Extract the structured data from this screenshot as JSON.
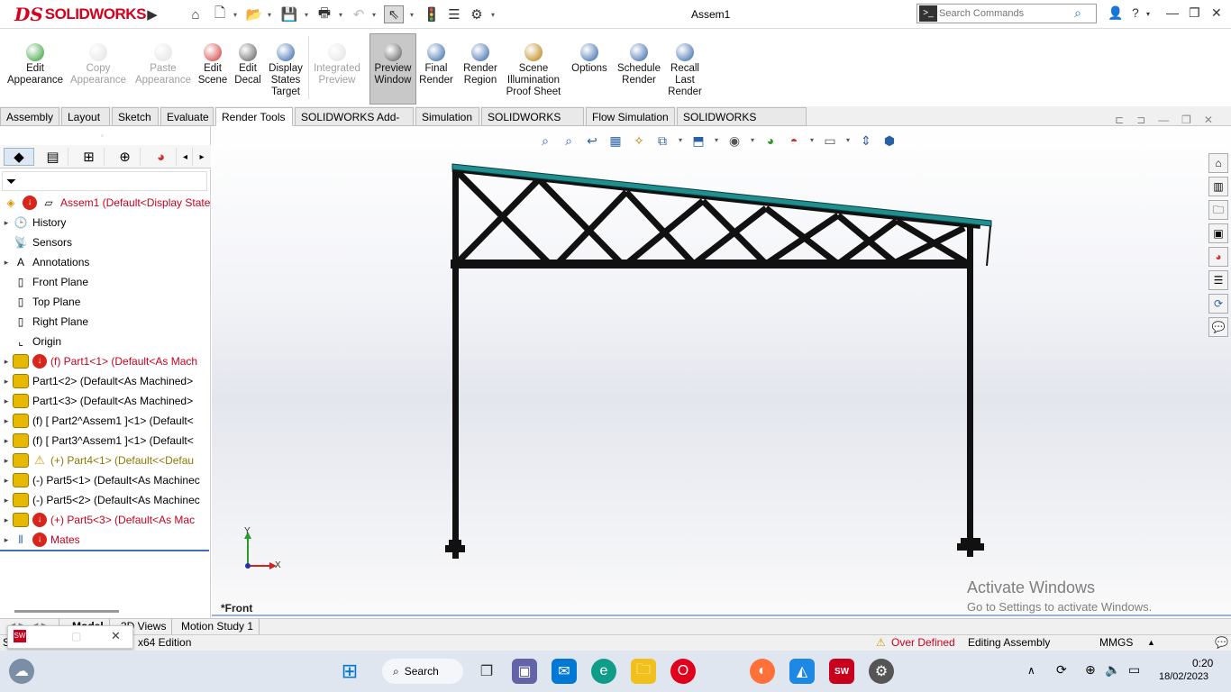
{
  "app": {
    "brand_ds": "DS",
    "brand_name": "SOLIDWORKS",
    "doc_title": "Assem1"
  },
  "search": {
    "placeholder": "Search Commands"
  },
  "ribbon": [
    {
      "label": "Edit\nAppearance",
      "icon": "appearance-icon",
      "enabled": true
    },
    {
      "label": "Copy\nAppearance",
      "icon": "copy-appearance-icon",
      "enabled": false
    },
    {
      "label": "Paste\nAppearance",
      "icon": "paste-appearance-icon",
      "enabled": false
    },
    {
      "label": "Edit\nScene",
      "icon": "scene-icon",
      "enabled": true
    },
    {
      "label": "Edit\nDecal",
      "icon": "decal-icon",
      "enabled": true
    },
    {
      "label": "Display\nStates\nTarget",
      "icon": "target-icon",
      "enabled": true
    },
    {
      "label": "Integrated\nPreview",
      "icon": "integrated-preview-icon",
      "enabled": false
    },
    {
      "label": "Preview\nWindow",
      "icon": "preview-window-icon",
      "enabled": true,
      "active": true
    },
    {
      "label": "Final\nRender",
      "icon": "final-render-icon",
      "enabled": true
    },
    {
      "label": "Render\nRegion",
      "icon": "render-region-icon",
      "enabled": true
    },
    {
      "label": "Scene\nIllumination\nProof Sheet",
      "icon": "proof-sheet-icon",
      "enabled": true
    },
    {
      "label": "Options",
      "icon": "options-icon",
      "enabled": true
    },
    {
      "label": "Schedule\nRender",
      "icon": "schedule-render-icon",
      "enabled": true
    },
    {
      "label": "Recall\nLast\nRender",
      "icon": "recall-render-icon",
      "enabled": true
    }
  ],
  "tabs": [
    "Assembly",
    "Layout",
    "Sketch",
    "Evaluate",
    "Render Tools",
    "SOLIDWORKS Add-Ins",
    "Simulation",
    "SOLIDWORKS MBD",
    "Flow Simulation",
    "SOLIDWORKS Inspection"
  ],
  "selected_tab": "Render Tools",
  "tree": {
    "root": "Assem1  (Default<Display State",
    "items": [
      {
        "label": "History",
        "kind": "history",
        "expand": true
      },
      {
        "label": "Sensors",
        "kind": "sensors",
        "expand": false
      },
      {
        "label": "Annotations",
        "kind": "annotations",
        "expand": true
      },
      {
        "label": "Front Plane",
        "kind": "plane",
        "expand": false
      },
      {
        "label": "Top Plane",
        "kind": "plane",
        "expand": false
      },
      {
        "label": "Right Plane",
        "kind": "plane",
        "expand": false
      },
      {
        "label": "Origin",
        "kind": "origin",
        "expand": false
      },
      {
        "label": "(f) Part1<1> (Default<As Mach",
        "kind": "part",
        "status": "error",
        "expand": true
      },
      {
        "label": "Part1<2> (Default<As Machined>",
        "kind": "part",
        "expand": true
      },
      {
        "label": "Part1<3> (Default<As Machined>",
        "kind": "part",
        "expand": true
      },
      {
        "label": "(f) [ Part2^Assem1 ]<1> (Default<",
        "kind": "part",
        "expand": true
      },
      {
        "label": "(f) [ Part3^Assem1 ]<1> (Default<",
        "kind": "part",
        "expand": true
      },
      {
        "label": "(+) Part4<1> (Default<<Defau",
        "kind": "part",
        "status": "warning",
        "expand": true
      },
      {
        "label": "(-) Part5<1> (Default<As Machinec",
        "kind": "part",
        "expand": true
      },
      {
        "label": "(-) Part5<2> (Default<As Machinec",
        "kind": "part",
        "expand": true
      },
      {
        "label": "(+) Part5<3> (Default<As Mac",
        "kind": "part",
        "status": "error",
        "expand": true
      },
      {
        "label": "Mates",
        "kind": "mates",
        "status": "error",
        "expand": true
      }
    ]
  },
  "viewport": {
    "view_label": "*Front",
    "triad": {
      "x": "X",
      "y": "Y"
    },
    "watermark": {
      "line1": "Activate Windows",
      "line2": "Go to Settings to activate Windows."
    }
  },
  "bottom_tabs": [
    "Model",
    "3D Views",
    "Motion Study 1"
  ],
  "status": {
    "edition": "x64 Edition",
    "over_defined": "Over Defined",
    "mode": "Editing Assembly",
    "units": "MMGS"
  },
  "taskbar": {
    "search": "Search",
    "time": "0:20",
    "date": "18/02/2023"
  },
  "colors": {
    "brand_red": "#d6001c",
    "roof_teal": "#1f8f8f",
    "error_red": "#c8001e"
  }
}
